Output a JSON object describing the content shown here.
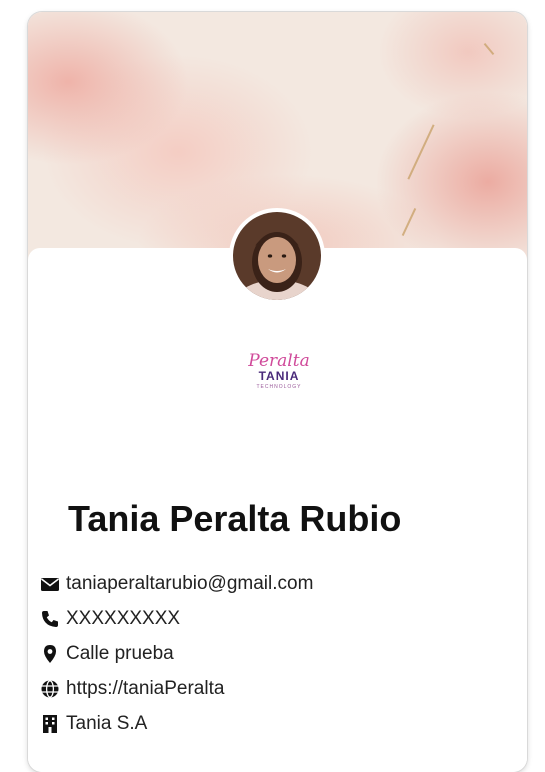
{
  "profile": {
    "name": "Tania Peralta Rubio",
    "logo": {
      "script": "Peralta",
      "word": "TANIA",
      "tagline": "TECHNOLOGY"
    },
    "contact": [
      {
        "icon": "envelope-icon",
        "text": "taniaperaltarubio@gmail.com"
      },
      {
        "icon": "phone-icon",
        "text": "XXXXXXXXX"
      },
      {
        "icon": "map-pin-icon",
        "text": "Calle prueba"
      },
      {
        "icon": "globe-icon",
        "text": "https://taniaPeralta"
      },
      {
        "icon": "building-icon",
        "text": "Tania S.A"
      }
    ]
  },
  "colors": {
    "cover_pink": "#eeaaa0",
    "cover_base": "#f3e8e0",
    "logo_pink": "#d04a9a",
    "logo_purple": "#4a2a7a",
    "name_text": "#111111"
  }
}
